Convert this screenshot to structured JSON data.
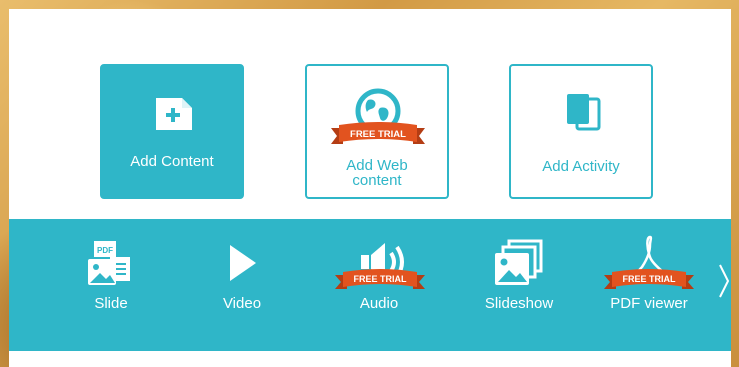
{
  "cards": [
    {
      "label": "Add Content",
      "icon": "add-document-icon"
    },
    {
      "label_line1": "Add Web",
      "label_line2": "content",
      "icon": "globe-icon",
      "badge": "FREE TRIAL"
    },
    {
      "label": "Add Activity",
      "icon": "activity-cards-icon"
    }
  ],
  "tools": [
    {
      "label": "Slide",
      "icon": "slide-pdf-image-icon"
    },
    {
      "label": "Video",
      "icon": "play-icon"
    },
    {
      "label": "Audio",
      "icon": "speaker-icon",
      "badge": "FREE TRIAL"
    },
    {
      "label": "Slideshow",
      "icon": "stacked-images-icon"
    },
    {
      "label": "PDF viewer",
      "icon": "pdf-acrobat-icon",
      "badge": "FREE TRIAL"
    }
  ],
  "badge_text": "FREE TRIAL",
  "colors": {
    "accent": "#2fb6c8",
    "ribbon": "#e2531f",
    "ribbon_dark": "#b43d14"
  }
}
